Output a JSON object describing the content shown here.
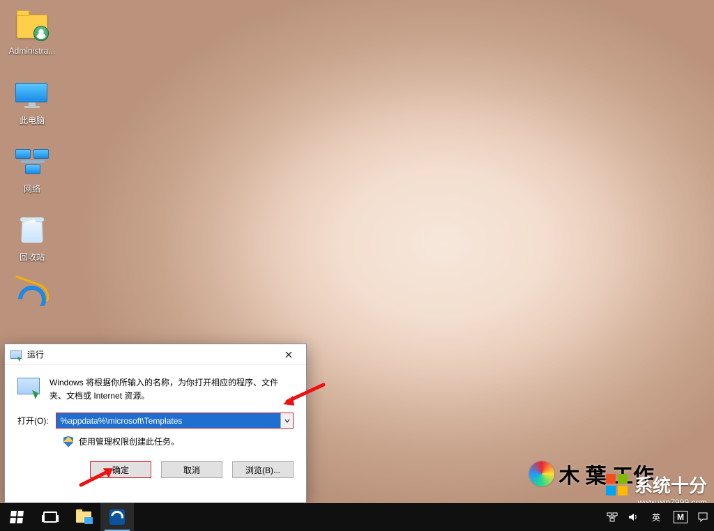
{
  "desktop": {
    "icons": [
      {
        "name": "administrator-folder",
        "label": "Administra..."
      },
      {
        "name": "this-pc",
        "label": "此电脑"
      },
      {
        "name": "network",
        "label": "网络"
      },
      {
        "name": "recycle-bin",
        "label": "回收站"
      },
      {
        "name": "internet-explorer",
        "label": ""
      }
    ]
  },
  "run_dialog": {
    "title": "运行",
    "description": "Windows 将根据你所输入的名称，为你打开相应的程序、文件夹、文档或 Internet 资源。",
    "open_label": "打开(O):",
    "open_value": "%appdata%\\microsoft\\Templates",
    "admin_note": "使用管理权限创建此任务。",
    "ok_label": "确定",
    "cancel_label": "取消",
    "browse_label": "浏览(B)..."
  },
  "taskbar": {
    "ime_lang": "英",
    "ime_mode": "M"
  },
  "watermark": {
    "brand": "系统十分",
    "url": "www.win7999.com",
    "leaf_text": "木 葉 工作"
  }
}
